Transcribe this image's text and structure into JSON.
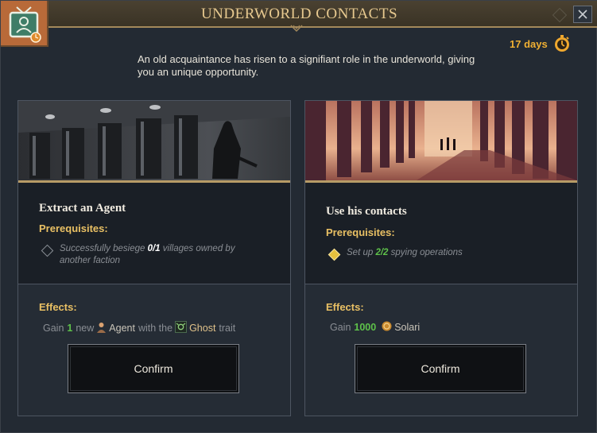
{
  "window": {
    "title": "UNDERWORLD CONTACTS",
    "timer_text": "17 days",
    "description": "An old acquaintance has risen to a signifiant role in the underworld, giving you an unique opportunity.",
    "accent_color": "#e7c98f"
  },
  "options": [
    {
      "title": "Extract an Agent",
      "prerequisites_label": "Prerequisites:",
      "prerequisite": {
        "before": "Successfully besiege ",
        "count": "0/1",
        "after": " villages owned by another faction",
        "met": false
      },
      "effects_label": "Effects:",
      "effect": {
        "gain": "Gain",
        "amount": "1",
        "word_new": "new",
        "resource_icon": "agent-icon",
        "resource": "Agent",
        "with_the": "with the",
        "trait_icon": "ghost-trait-icon",
        "trait": "Ghost",
        "suffix": "trait"
      },
      "confirm_label": "Confirm"
    },
    {
      "title": "Use his contacts",
      "prerequisites_label": "Prerequisites:",
      "prerequisite": {
        "before": "Set up ",
        "count": "2/2",
        "after": " spying operations",
        "met": true
      },
      "effects_label": "Effects:",
      "effect": {
        "gain": "Gain",
        "amount": "1000",
        "resource_icon": "solari-coin-icon",
        "resource": "Solari"
      },
      "confirm_label": "Confirm"
    }
  ]
}
